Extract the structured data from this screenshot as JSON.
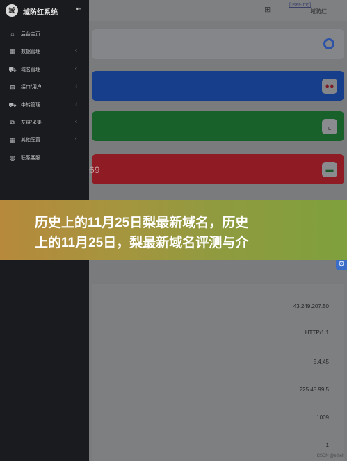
{
  "sidebar": {
    "logo_text": "域",
    "title": "域防红系统",
    "collapse_icon": "⇤",
    "items": [
      {
        "label": "后台主页",
        "icon": "home-icon",
        "has_chevron": false
      },
      {
        "label": "数据管理",
        "icon": "grid-icon",
        "has_chevron": true
      },
      {
        "label": "域名管理",
        "icon": "cart-icon",
        "has_chevron": true
      },
      {
        "label": "接口/用户",
        "icon": "plug-icon",
        "has_chevron": true
      },
      {
        "label": "中转管理",
        "icon": "cart-icon",
        "has_chevron": true
      },
      {
        "label": "友链/采集",
        "icon": "copy-icon",
        "has_chevron": true
      },
      {
        "label": "其他配置",
        "icon": "grid-icon",
        "has_chevron": true
      },
      {
        "label": "联系客服",
        "icon": "headset-icon",
        "has_chevron": false
      }
    ],
    "chevron": "‹"
  },
  "topbar": {
    "grid_icon": "⊞",
    "avatar_alt": "[user-img]",
    "username": "域防红"
  },
  "cards": {
    "red_value": "69"
  },
  "stats": [
    "43.249.207.50",
    "HTTP/1.1",
    "5.4.45",
    "225.45.99.5",
    "1009",
    "1"
  ],
  "footer_credit": "CSDN @ethelf",
  "banner": {
    "line1": "历史上的11月25日梨最新域名，历史",
    "line2": "上的11月25日，梨最新域名评测与介"
  },
  "colors": {
    "sidebar_bg": "#1a1b1e",
    "card_blue": "#163e8a",
    "card_green": "#19612a",
    "card_red": "#8f1c24",
    "banner_start": "#b6893c",
    "banner_end": "#7fa03d"
  }
}
